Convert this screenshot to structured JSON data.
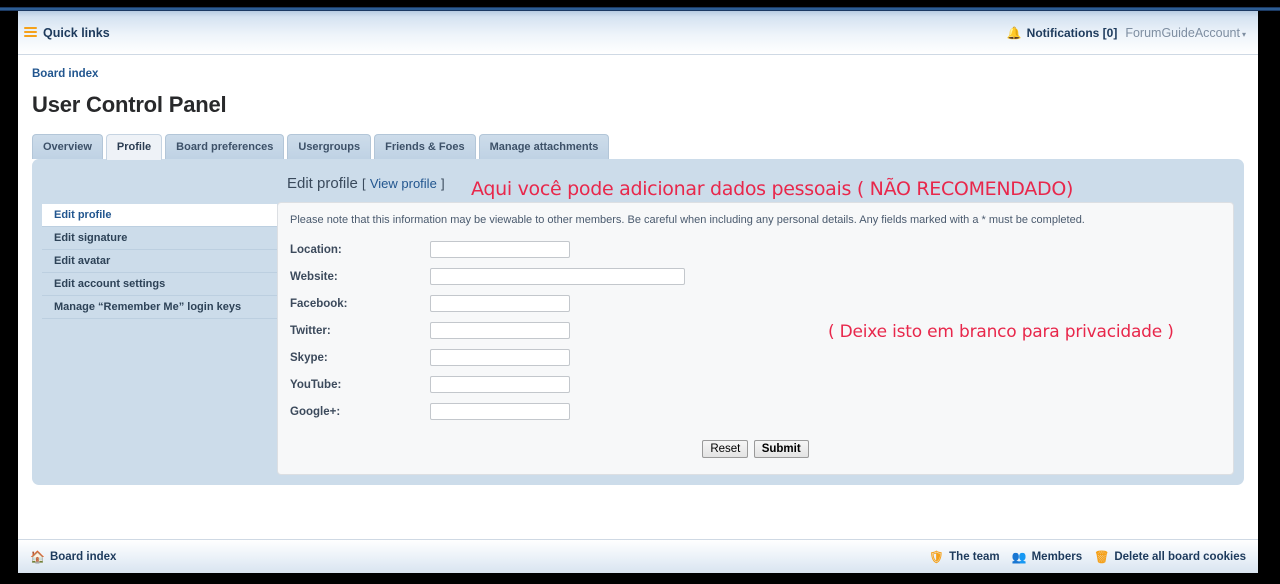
{
  "navbar": {
    "quick_links": "Quick links",
    "menu_icon": "hamburger-icon",
    "notifications": "Notifications [0]",
    "bell_icon": "bell-icon",
    "account": "ForumGuideAccount",
    "caret": "▾"
  },
  "breadcrumb": {
    "board_index": "Board index"
  },
  "page_title": "User Control Panel",
  "tabs": [
    {
      "label": "Overview",
      "active": false
    },
    {
      "label": "Profile",
      "active": true
    },
    {
      "label": "Board preferences",
      "active": false
    },
    {
      "label": "Usergroups",
      "active": false
    },
    {
      "label": "Friends & Foes",
      "active": false
    },
    {
      "label": "Manage attachments",
      "active": false
    }
  ],
  "panel": {
    "title": "Edit profile",
    "bracket_open": "[",
    "view_profile": "View profile",
    "bracket_close": "]"
  },
  "sidenav": [
    {
      "label": "Edit profile",
      "active": true
    },
    {
      "label": "Edit signature",
      "active": false
    },
    {
      "label": "Edit avatar",
      "active": false
    },
    {
      "label": "Edit account settings",
      "active": false
    },
    {
      "label": "Manage “Remember Me” login keys",
      "active": false
    }
  ],
  "form": {
    "note": "Please note that this information may be viewable to other members. Be careful when including any personal details. Any fields marked with a * must be completed.",
    "fields": [
      {
        "label": "Location:",
        "value": "",
        "size": "sm"
      },
      {
        "label": "Website:",
        "value": "",
        "size": "lg"
      },
      {
        "label": "Facebook:",
        "value": "",
        "size": "sm"
      },
      {
        "label": "Twitter:",
        "value": "",
        "size": "sm"
      },
      {
        "label": "Skype:",
        "value": "",
        "size": "sm"
      },
      {
        "label": "YouTube:",
        "value": "",
        "size": "sm"
      },
      {
        "label": "Google+:",
        "value": "",
        "size": "sm"
      }
    ],
    "reset_label": "Reset",
    "submit_label": "Submit"
  },
  "annotations": {
    "top": "Aqui você pode adicionar dados pessoais ( NÃO RECOMENDADO)",
    "middle": "( Deixe isto em branco para privacidade )",
    "color": "#e8274b"
  },
  "footer": {
    "board_index": "Board index",
    "home_icon": "home-icon",
    "the_team": "The team",
    "shield_icon": "shield-icon",
    "members": "Members",
    "members_icon": "people-icon",
    "delete_cookies": "Delete all board cookies",
    "trash_icon": "trash-icon"
  }
}
